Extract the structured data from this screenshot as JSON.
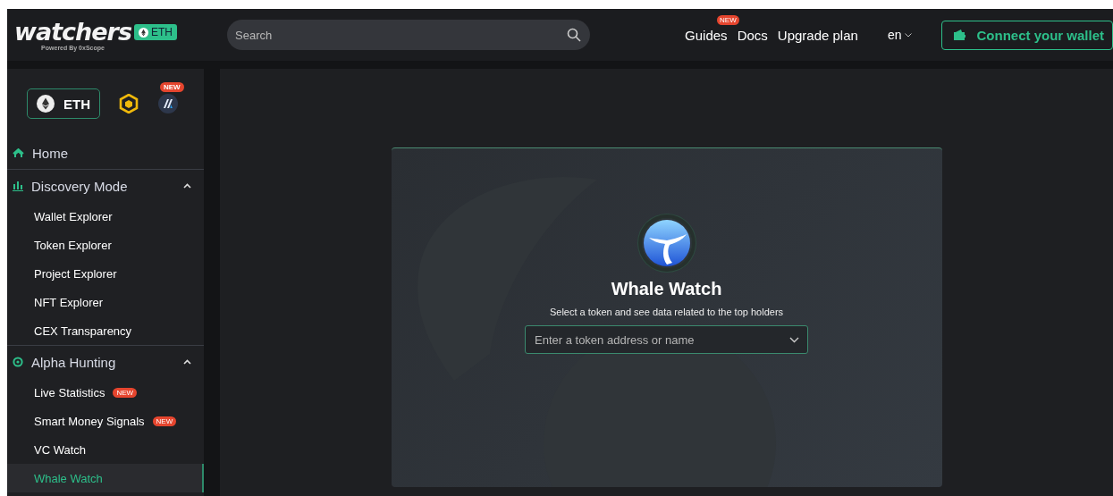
{
  "header": {
    "logo": {
      "wordmark": "watchers",
      "tagline": "Powered By 0xScope",
      "chain_chip": "ETH"
    },
    "search": {
      "placeholder": "Search"
    },
    "nav": [
      {
        "label": "Guides",
        "badge": "NEW"
      },
      {
        "label": "Docs"
      },
      {
        "label": "Upgrade plan"
      }
    ],
    "language": "en",
    "connect_button": "Connect your wallet"
  },
  "sidebar": {
    "chains": [
      {
        "kind": "eth",
        "label": "ETH",
        "selected": true
      },
      {
        "kind": "bnb",
        "selected": false
      },
      {
        "kind": "arbitrum",
        "selected": false,
        "badge": "NEW"
      }
    ],
    "sections": [
      {
        "kind": "home",
        "label": "Home"
      },
      {
        "kind": "chart",
        "label": "Discovery Mode",
        "expanded": true,
        "children": [
          {
            "label": "Wallet Explorer",
            "selected": false
          },
          {
            "label": "Token Explorer",
            "selected": false
          },
          {
            "label": "Project Explorer",
            "selected": false
          },
          {
            "label": "NFT Explorer",
            "selected": false
          },
          {
            "label": "CEX Transparency",
            "selected": false
          }
        ]
      },
      {
        "kind": "target",
        "label": "Alpha Hunting",
        "expanded": true,
        "children": [
          {
            "label": "Live Statistics",
            "selected": false,
            "badge": "NEW"
          },
          {
            "label": "Smart Money Signals",
            "selected": false,
            "badge": "NEW"
          },
          {
            "label": "VC Watch",
            "selected": false
          },
          {
            "label": "Whale Watch",
            "selected": true
          }
        ]
      }
    ]
  },
  "main": {
    "title": "Whale Watch",
    "subtitle": "Select a token and see data related to the top holders",
    "token_select": {
      "placeholder": "Enter a token address or name"
    }
  }
}
